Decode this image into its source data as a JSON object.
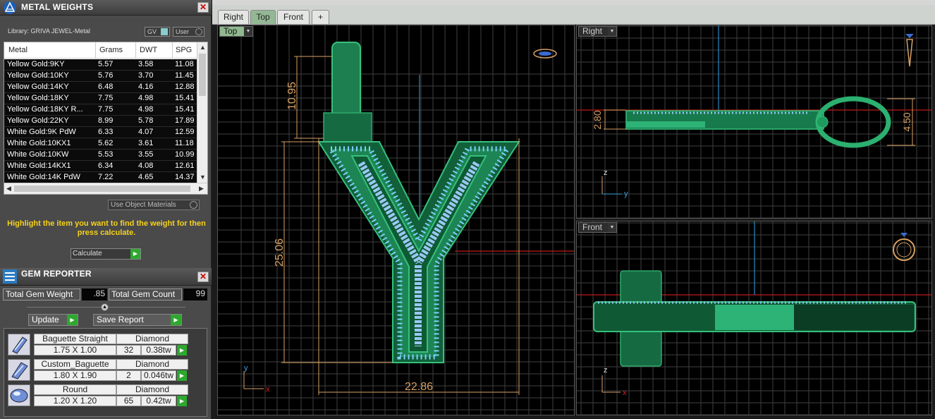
{
  "colors": {
    "panel": "#4a4a4a",
    "table_row_bg": "#0b0b0b",
    "hint": "#f6d21b",
    "play_button": "#2ea82e",
    "viewport_bg": "#000000",
    "grid": "#4a4a4a",
    "model_green": "#1f9a5e",
    "gem_blue": "#8ec6f0",
    "dimension": "#d7a064",
    "axis_red": "#e02020",
    "axis_blue": "#3aa3e0"
  },
  "metal_weights": {
    "title": "METAL WEIGHTS",
    "library": "Library: GRIVA JEWEL-Metal",
    "gv_label": "GV",
    "user_label": "User",
    "columns": [
      "Metal",
      "Grams",
      "DWT",
      "SPG"
    ],
    "rows": [
      [
        "Yellow Gold:9KY",
        "5.57",
        "3.58",
        "11.08"
      ],
      [
        "Yellow Gold:10KY",
        "5.76",
        "3.70",
        "11.45"
      ],
      [
        "Yellow Gold:14KY",
        "6.48",
        "4.16",
        "12.88"
      ],
      [
        "Yellow Gold:18KY",
        "7.75",
        "4.98",
        "15.41"
      ],
      [
        "Yellow Gold:18KY R...",
        "7.75",
        "4.98",
        "15.41"
      ],
      [
        "Yellow Gold:22KY",
        "8.99",
        "5.78",
        "17.89"
      ],
      [
        "White Gold:9K PdW",
        "6.33",
        "4.07",
        "12.59"
      ],
      [
        "White Gold:10KX1",
        "5.62",
        "3.61",
        "11.18"
      ],
      [
        "White Gold:10KW",
        "5.53",
        "3.55",
        "10.99"
      ],
      [
        "White Gold:14KX1",
        "6.34",
        "4.08",
        "12.61"
      ],
      [
        "White Gold:14K PdW",
        "7.22",
        "4.65",
        "14.37"
      ]
    ],
    "use_object_materials": "Use Object Materials",
    "hint": "Highlight the item you want to find the weight for then press calculate.",
    "calculate": "Calculate"
  },
  "gem_reporter": {
    "title": "GEM REPORTER",
    "total_weight_label": "Total Gem Weight",
    "total_weight": ".85",
    "total_count_label": "Total Gem Count",
    "total_count": "99",
    "update": "Update",
    "save_report": "Save Report",
    "gems": [
      {
        "shape": "Baguette Straight",
        "material": "Diamond",
        "size": "1.75 X 1.00",
        "count": "32",
        "weight": "0.38tw"
      },
      {
        "shape": "Custom_Baguette",
        "material": "Diamond",
        "size": "1.80 X 1.90",
        "count": "2",
        "weight": "0.046tw"
      },
      {
        "shape": "Round",
        "material": "Diamond",
        "size": "1.20 X 1.20",
        "count": "65",
        "weight": "0.42tw"
      }
    ]
  },
  "tabs": [
    "Right",
    "Top",
    "Front",
    "+"
  ],
  "viewports": {
    "top": {
      "label": "Top",
      "dims": {
        "h_top": "10.95",
        "h_main": "25.06",
        "w": "22.86"
      },
      "axes": {
        "y": "y",
        "x": "x"
      }
    },
    "right": {
      "label": "Right",
      "dims": {
        "h": "2.80",
        "h2": "4.50"
      },
      "axes": {
        "z": "z",
        "y": "y"
      }
    },
    "front": {
      "label": "Front",
      "axes": {
        "z": "z",
        "x": "x"
      }
    }
  }
}
